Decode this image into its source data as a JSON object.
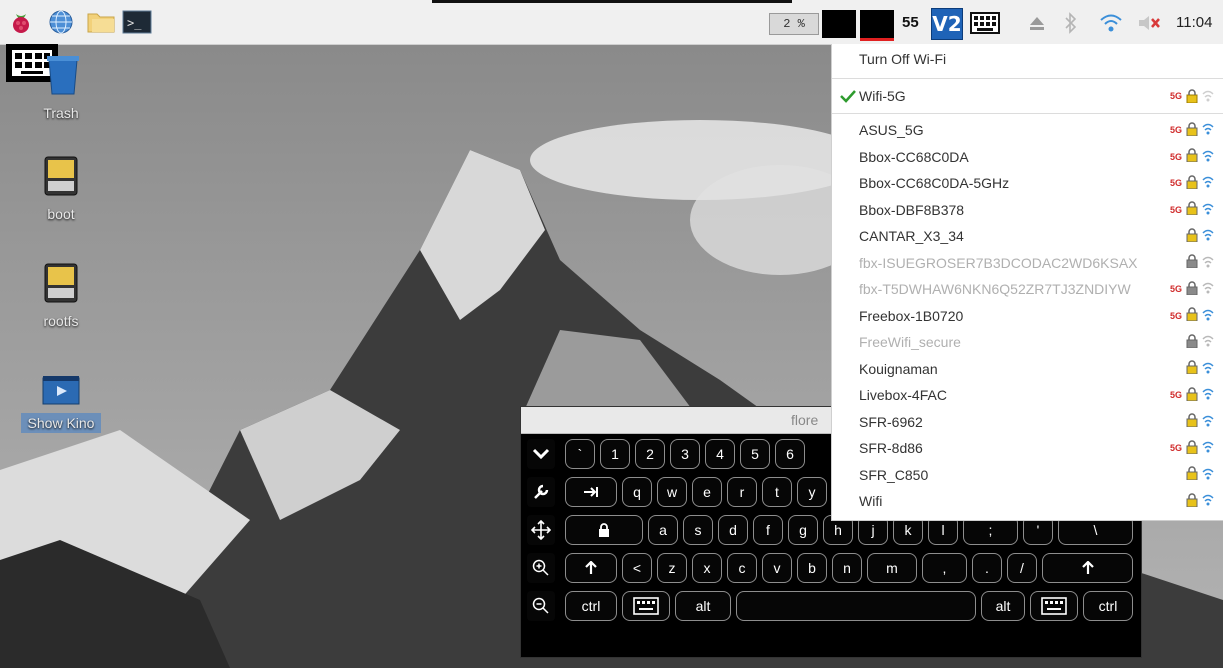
{
  "panel": {
    "cpu_label": "2 %",
    "counter": "55",
    "vnc_label": "V2",
    "clock": "11:04"
  },
  "desktop": {
    "icons": [
      {
        "label": "Trash"
      },
      {
        "label": "boot"
      },
      {
        "label": "rootfs"
      },
      {
        "label": "Show Kino"
      }
    ]
  },
  "wifi_menu": {
    "turn_off": "Turn Off Wi-Fi",
    "connected": "Wifi-5G",
    "networks": [
      {
        "name": "ASUS_5G",
        "band": "5G",
        "dimmed": false
      },
      {
        "name": "Bbox-CC68C0DA",
        "band": "5G",
        "dimmed": false
      },
      {
        "name": "Bbox-CC68C0DA-5GHz",
        "band": "5G",
        "dimmed": false
      },
      {
        "name": "Bbox-DBF8B378",
        "band": "5G",
        "dimmed": false
      },
      {
        "name": "CANTAR_X3_34",
        "band": "",
        "dimmed": false
      },
      {
        "name": "fbx-ISUEGROSER7B3DCODAC2WD6KSAX",
        "band": "",
        "dimmed": true
      },
      {
        "name": "fbx-T5DWHAW6NKN6Q52ZR7TJ3ZNDIYW",
        "band": "5G",
        "dimmed": true
      },
      {
        "name": "Freebox-1B0720",
        "band": "5G",
        "dimmed": false
      },
      {
        "name": "FreeWifi_secure",
        "band": "",
        "dimmed": true
      },
      {
        "name": "Kouignaman",
        "band": "",
        "dimmed": false
      },
      {
        "name": "Livebox-4FAC",
        "band": "5G",
        "dimmed": false
      },
      {
        "name": "SFR-6962",
        "band": "",
        "dimmed": false
      },
      {
        "name": "SFR-8d86",
        "band": "5G",
        "dimmed": false
      },
      {
        "name": "SFR_C850",
        "band": "",
        "dimmed": false
      },
      {
        "name": "Wifi",
        "band": "",
        "dimmed": false
      }
    ]
  },
  "keyboard": {
    "title": "flore",
    "rows": [
      [
        "`",
        "1",
        "2",
        "3",
        "4",
        "5",
        "6"
      ],
      [
        "q",
        "w",
        "e",
        "r",
        "t",
        "y"
      ],
      [
        "a",
        "s",
        "d",
        "f",
        "g",
        "h",
        "j",
        "k",
        "l",
        ";",
        "'",
        "\\"
      ],
      [
        "<",
        "z",
        "x",
        "c",
        "v",
        "b",
        "n",
        "m",
        ",",
        ".",
        "/"
      ],
      [
        "ctrl",
        "alt",
        "alt",
        "ctrl"
      ]
    ]
  },
  "colors": {
    "accent_blue": "#1f63b7",
    "check_green": "#2e9b2e",
    "five_g_red": "#d02b2b",
    "lock_yellow": "#e8c21a"
  }
}
